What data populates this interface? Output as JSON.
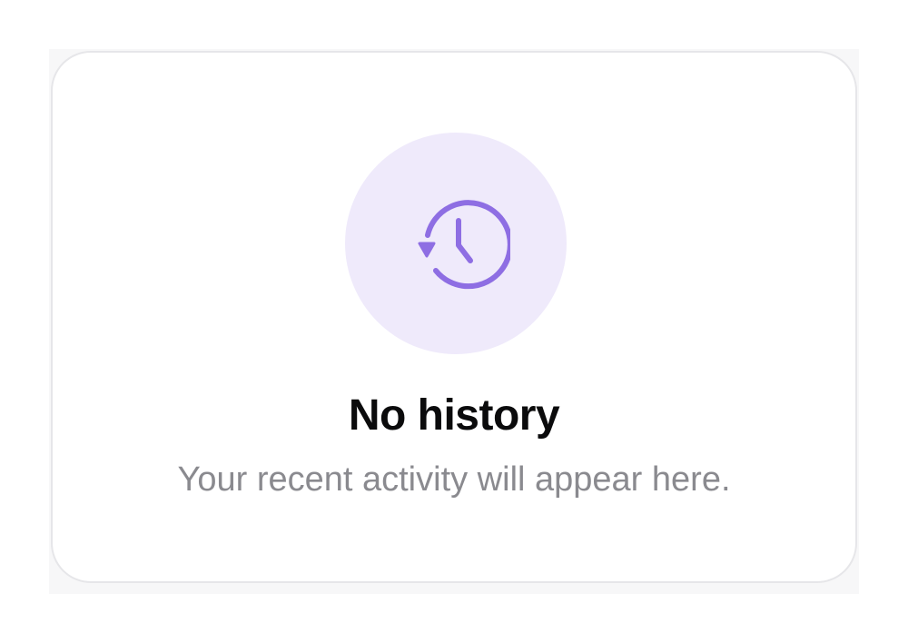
{
  "empty_state": {
    "icon": "history-icon",
    "title": "No history",
    "subtitle": "Your recent activity will appear here."
  },
  "colors": {
    "accent": "#8e6ee3",
    "icon_background": "#efeafb",
    "title": "#0b0b0c",
    "subtitle": "#8a8a8f",
    "card_border": "#e6e6e9"
  }
}
